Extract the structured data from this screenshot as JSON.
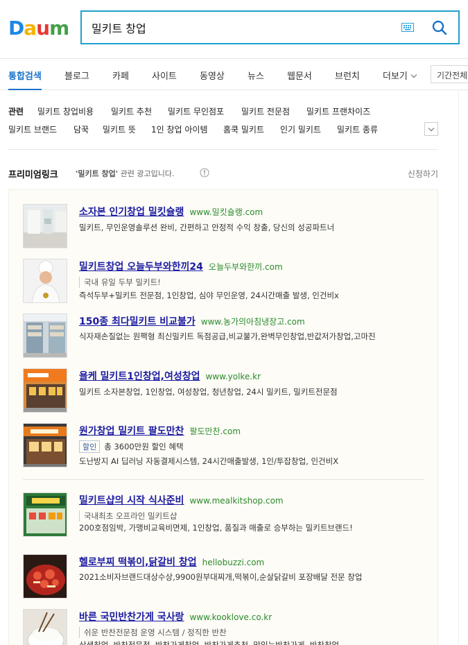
{
  "header": {
    "logo_text": "Daum",
    "search_value": "밀키트 창업"
  },
  "tabs": [
    {
      "label": "통합검색",
      "active": true
    },
    {
      "label": "블로그"
    },
    {
      "label": "카페"
    },
    {
      "label": "사이트"
    },
    {
      "label": "동영상"
    },
    {
      "label": "뉴스"
    },
    {
      "label": "웹문서"
    },
    {
      "label": "브런치"
    },
    {
      "label": "더보기"
    }
  ],
  "period_label": "기간전체",
  "related": {
    "title": "관련",
    "row1": [
      "밀키트 창업비용",
      "밀키트 추천",
      "밀키트 무인점포",
      "밀키트 전문점",
      "밀키트 프랜차이즈"
    ],
    "row2": [
      "밀키트 브랜드",
      "담꾹",
      "밀키트 뜻",
      "1인 창업 아이템",
      "홈쿡 밀키트",
      "인기 밀키트",
      "밀키트 종류"
    ]
  },
  "premium": {
    "title": "프리미엄링크",
    "desc_keyword": "'밀키트 창업'",
    "desc_rest": " 관련 광고입니다.",
    "apply": "신청하기"
  },
  "ads": [
    {
      "title": "소자본 인기창업 밀킷슐랭",
      "url": "www.밀킷슐랭.com",
      "line1": "밀키트, 무인운영솔루션 완비, 간편하고 안정적 수익 창출, 당신의 성공파트너"
    },
    {
      "title": "밀키트창업 오늘두부와한끼24",
      "url": "오늘두부와한끼.com",
      "sub": "국내 유일 두부 밀키트!",
      "line1": "즉석두부+밀키트 전문점, 1인창업, 심야 무인운영, 24시간매출 발생, 인건비x"
    },
    {
      "title": "150종 최다밀키트 비교불가",
      "url": "www.농가의아침냉장고.com",
      "line1": "식자재손질없는 원팩형 최신밀키트 독점공급,비교불가,완벽무인창업,반값저가창업,고마진"
    },
    {
      "title": "욜케 밀키트1인창업,여성창업",
      "url": "www.yolke.kr",
      "line1": "밀키트 소자본창업, 1인창업, 여성창업, 청년창업, 24시 밀키트, 밀키트전문점"
    },
    {
      "title": "원가창업 밀키트 팔도만찬",
      "url": "팔도만찬.com",
      "tag": "할인",
      "sub": "총 3600만원 할인 혜택",
      "line1": "도난방지 AI 딥러닝 자동결제시스템, 24시간매출발생, 1인/투잡창업, 인건비X"
    },
    {
      "title": "밀키트샵의 시작 식사준비",
      "url": "www.mealkitshop.com",
      "sub": "국내최초 오프라인 밀키트샵",
      "line1": "200호점임박, 가맹비교육비면제, 1인창업, 품질과 매출로 승부하는 밀키트브랜드!"
    },
    {
      "title": "헬로부찌 떡볶이,닭갈비 창업",
      "url": "hellobuzzi.com",
      "line1": "2021소비자브랜드대상수상,9900원부대찌개,떡볶이,순살닭갈비 포장배달 전문 창업"
    },
    {
      "title": "바른 국민반찬가게 국사랑",
      "url": "www.kooklove.co.kr",
      "sub": "쉬운 반찬전문점 운영 시스템 / 정직한 반찬",
      "line1": "상생창업, 반찬전문점, 반찬가게창업, 반찬가게추천, 맛있는반찬가게, 반찬창업"
    }
  ],
  "colors": {
    "accent": "#1a73c9",
    "search_border": "#1ea1c9",
    "ad_title": "#1b1ba1",
    "ad_url": "#2a8a2a"
  }
}
